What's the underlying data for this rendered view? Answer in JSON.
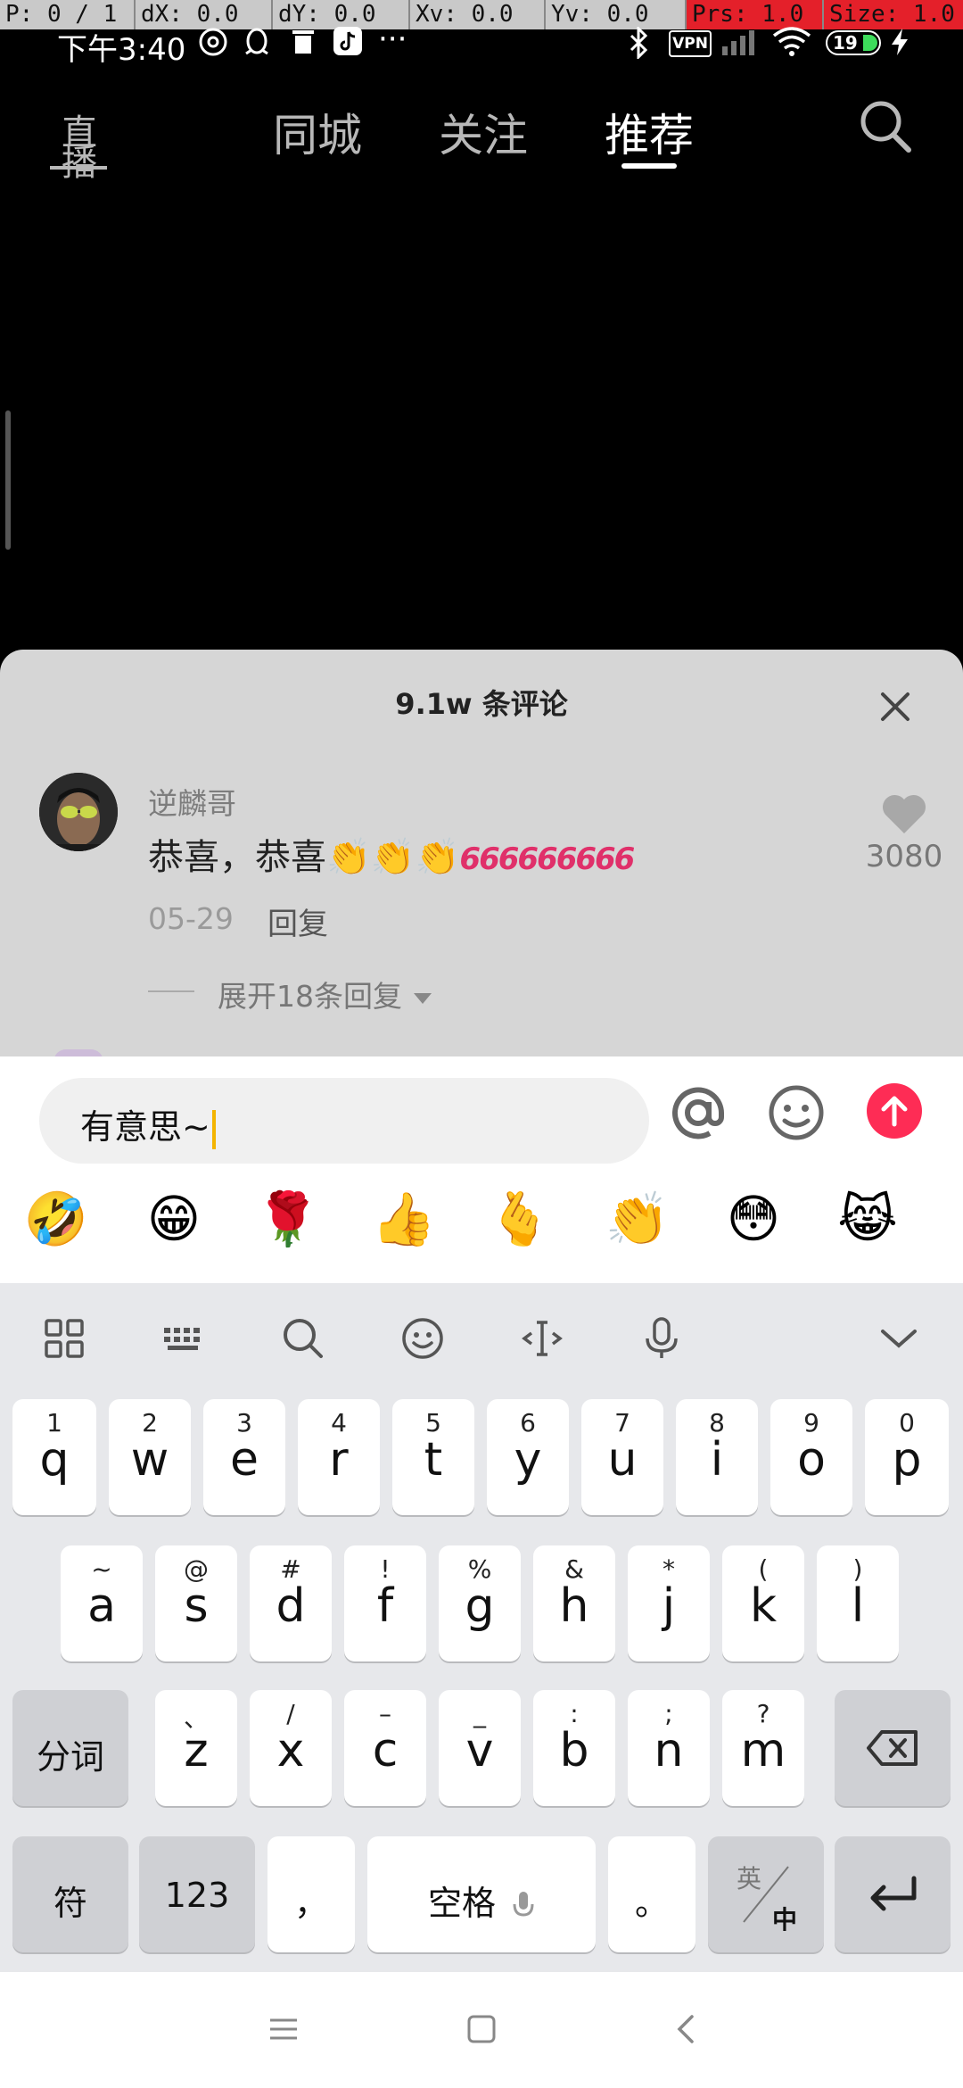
{
  "debug": {
    "p": "P: 0 / 1",
    "dx": "dX: 0.0",
    "dy": "dY: 0.0",
    "xv": "Xv: 0.0",
    "yv": "Yv: 0.0",
    "prs": "Prs: 1.0",
    "size": "Size: 1.0"
  },
  "status": {
    "time": "下午3:40",
    "dots": "···",
    "vpn": "VPN",
    "battery": "19"
  },
  "nav": {
    "live": "直播",
    "tabs": [
      "同城",
      "关注",
      "推荐"
    ],
    "active_tab": "推荐"
  },
  "comments": {
    "title": "9.1w 条评论",
    "item": {
      "username": "逆麟哥",
      "text": "恭喜，恭喜👏👏👏",
      "text_tail": "666666666",
      "date": "05-29",
      "reply": "回复",
      "expand": "展开18条回复",
      "likes": "3080"
    }
  },
  "input": {
    "value": "有意思~"
  },
  "emojis": [
    "🤣",
    "😁",
    "🌹",
    "👍",
    "🫰",
    "👏",
    "😳",
    "😹"
  ],
  "keyboard": {
    "row1": [
      {
        "hint": "1",
        "key": "q"
      },
      {
        "hint": "2",
        "key": "w"
      },
      {
        "hint": "3",
        "key": "e"
      },
      {
        "hint": "4",
        "key": "r"
      },
      {
        "hint": "5",
        "key": "t"
      },
      {
        "hint": "6",
        "key": "y"
      },
      {
        "hint": "7",
        "key": "u"
      },
      {
        "hint": "8",
        "key": "i"
      },
      {
        "hint": "9",
        "key": "o"
      },
      {
        "hint": "0",
        "key": "p"
      }
    ],
    "row2": [
      {
        "hint": "~",
        "key": "a"
      },
      {
        "hint": "@",
        "key": "s"
      },
      {
        "hint": "#",
        "key": "d"
      },
      {
        "hint": "!",
        "key": "f"
      },
      {
        "hint": "%",
        "key": "g"
      },
      {
        "hint": "&",
        "key": "h"
      },
      {
        "hint": "*",
        "key": "j"
      },
      {
        "hint": "(",
        "key": "k"
      },
      {
        "hint": ")",
        "key": "l"
      }
    ],
    "row3": [
      {
        "hint": "、",
        "key": "z"
      },
      {
        "hint": "/",
        "key": "x"
      },
      {
        "hint": "–",
        "key": "c"
      },
      {
        "hint": "_",
        "key": "v"
      },
      {
        "hint": ":",
        "key": "b"
      },
      {
        "hint": ";",
        "key": "n"
      },
      {
        "hint": "?",
        "key": "m"
      }
    ],
    "fenci": "分词",
    "fu": "符",
    "num": "123",
    "comma": "，",
    "space": "空格",
    "period": "。",
    "lang_top": "英",
    "lang_bottom": "中"
  },
  "colors": {
    "accent": "#fe2c55",
    "caret": "#f4b400",
    "sheet_bg": "#d6d6d6"
  }
}
